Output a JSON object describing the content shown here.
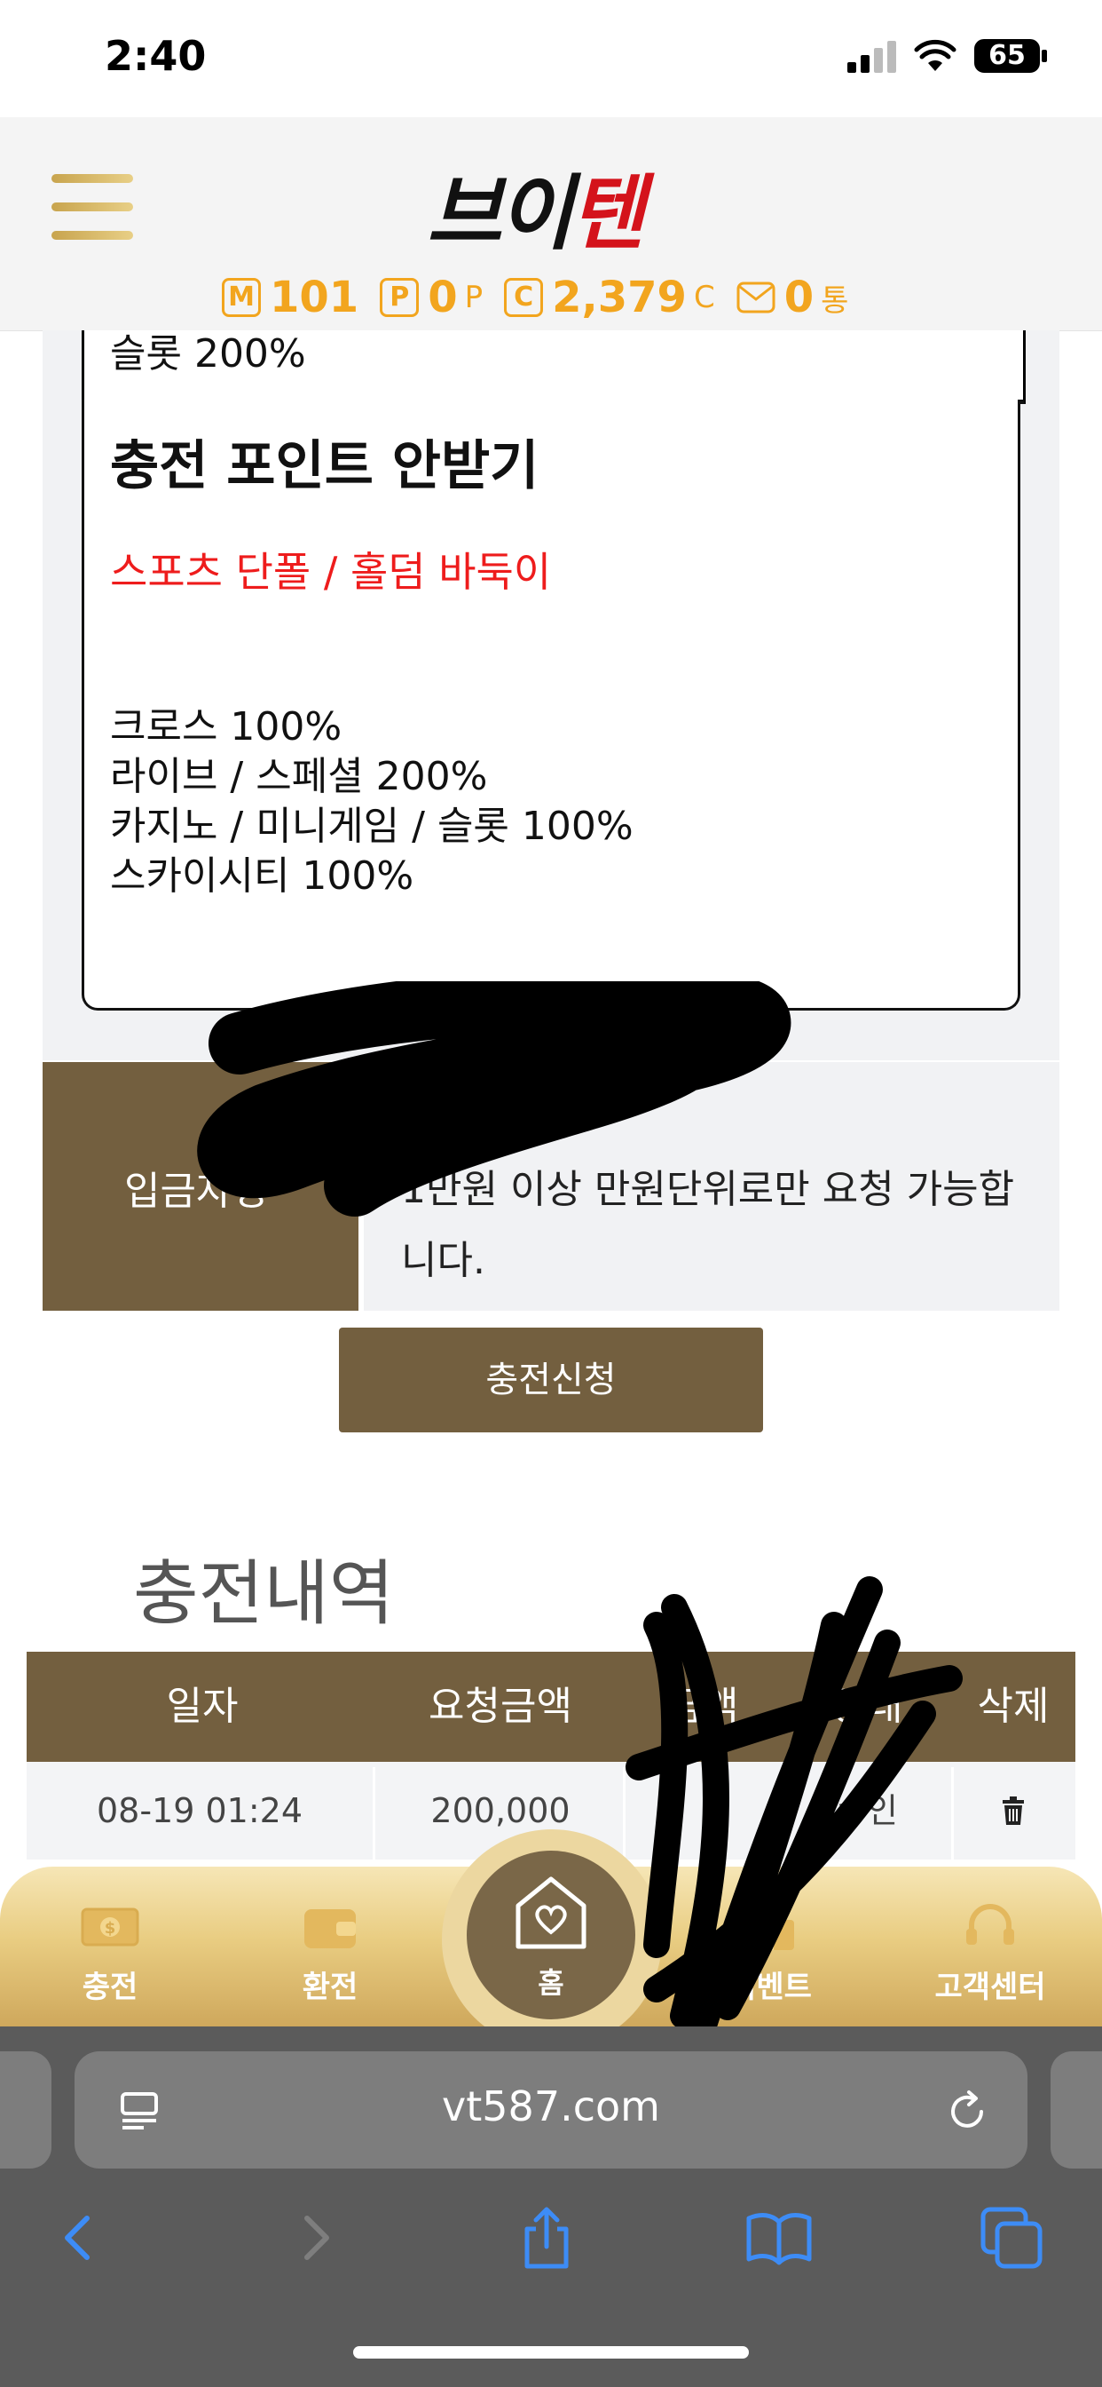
{
  "status_bar": {
    "time": "2:40",
    "battery": "65"
  },
  "header": {
    "logo_part1": "브이",
    "logo_part2": "텐",
    "stats": [
      {
        "icon": "M",
        "value": "101",
        "unit": ""
      },
      {
        "icon": "P",
        "value": "0",
        "unit": "P"
      },
      {
        "icon": "C",
        "value": "2,379",
        "unit": "C"
      },
      {
        "icon": "mail-icon",
        "value": "0",
        "unit": "통"
      }
    ]
  },
  "policy": {
    "cut_line": "슬롯 200%",
    "title": "충전 포인트 안받기",
    "subtitle": "스포츠 단폴 / 홀덤 바둑이",
    "lines": [
      "크로스 100%",
      "라이브 / 스페셜 200%",
      "카지노 / 미니게임 / 슬롯 100%",
      "스카이시티 100%"
    ]
  },
  "deposit": {
    "label": "입금자명",
    "note": "1만원 이상 만원단위로만 요청 가능합니다."
  },
  "submit_label": "충전신청",
  "history": {
    "title": "충전내역",
    "columns": [
      "일자",
      "요청금액",
      "금액",
      "상태",
      "삭제"
    ],
    "rows": [
      {
        "date": "08-19 01:24",
        "amount": "200,000",
        "amount2": "",
        "status": "승인"
      }
    ]
  },
  "bottom_nav": {
    "items": [
      "충전",
      "환전",
      "홈",
      "이벤트",
      "고객센터"
    ]
  },
  "browser": {
    "url": "vt587.com"
  },
  "colors": {
    "brown": "#735f3f",
    "gold": "#e9cd82",
    "accent_orange": "#f2a51e",
    "red": "#ee1c1c"
  }
}
